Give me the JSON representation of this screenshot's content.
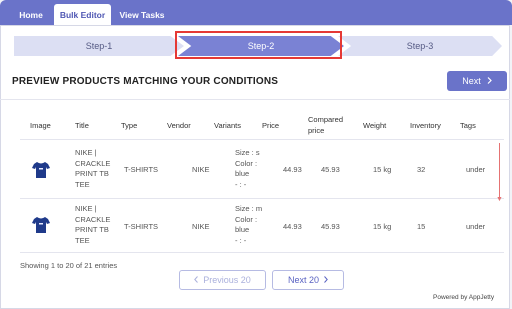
{
  "nav": {
    "tabs": [
      {
        "label": "Home"
      },
      {
        "label": "Bulk Editor"
      },
      {
        "label": "View Tasks"
      }
    ],
    "active_tab": "Bulk Editor",
    "colors": {
      "bar": "#6a73c9",
      "active_text": "#4f57b3"
    }
  },
  "stepper": {
    "steps": [
      {
        "label": "Step-1"
      },
      {
        "label": "Step-2"
      },
      {
        "label": "Step-3"
      }
    ],
    "current": "Step-2",
    "highlight_color": "#e53935"
  },
  "preview": {
    "heading": "PREVIEW PRODUCTS MATCHING YOUR CONDITIONS",
    "next_label": "Next",
    "next_icon": "chevron-right-icon"
  },
  "table": {
    "columns": [
      "Image",
      "Title",
      "Type",
      "Vendor",
      "Variants",
      "Price",
      "Compared price",
      "Weight",
      "Inventory",
      "Tags"
    ],
    "rows": [
      {
        "image": "tshirt-thumbnail",
        "title": "NIKE | CRACKLE PRINT TB TEE",
        "type": "T-SHIRTS",
        "vendor": "NIKE",
        "variants": [
          "Size : s",
          "Color :",
          "blue",
          "- : -"
        ],
        "price": "44.93",
        "compared_price": "45.93",
        "weight": "15 kg",
        "inventory": "32",
        "tags": "under"
      },
      {
        "image": "tshirt-thumbnail",
        "title": "NIKE | CRACKLE PRINT TB TEE",
        "type": "T-SHIRTS",
        "vendor": "NIKE",
        "variants": [
          "Size : m",
          "Color :",
          "blue",
          "- : -"
        ],
        "price": "44.93",
        "compared_price": "45.93",
        "weight": "15 kg",
        "inventory": "15",
        "tags": "under"
      }
    ]
  },
  "pagination": {
    "showing": "Showing 1 to 20 of 21 entries",
    "previous_label": "Previous 20",
    "next_label": "Next 20"
  },
  "footer": {
    "powered_by": "Powered by AppJetty"
  }
}
